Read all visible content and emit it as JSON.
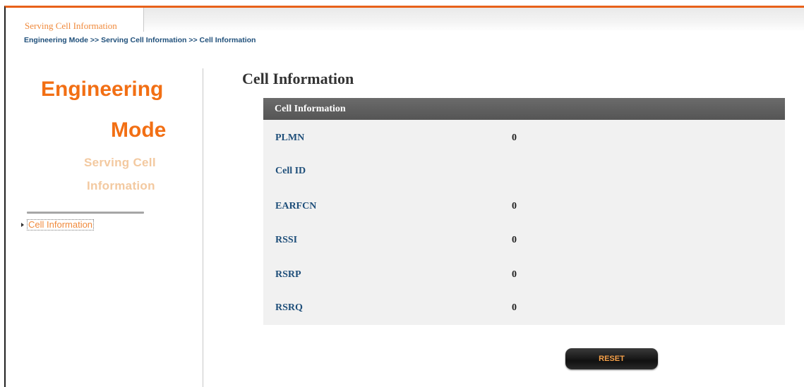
{
  "tab": {
    "label": "Serving Cell Information"
  },
  "breadcrumb": "Engineering Mode >> Serving Cell Information >> Cell Information",
  "sidebar": {
    "title_line1": "Engineering",
    "title_line2": "Mode",
    "subtitle_line1": "Serving Cell",
    "subtitle_line2": "Information",
    "items": [
      {
        "label": "Cell Information"
      }
    ]
  },
  "main": {
    "page_title": "Cell Information",
    "panel_title": "Cell Information",
    "rows": [
      {
        "label": "PLMN",
        "value": "0"
      },
      {
        "label": "Cell ID",
        "value": ""
      },
      {
        "label": "EARFCN",
        "value": "0"
      },
      {
        "label": "RSSI",
        "value": "0"
      },
      {
        "label": "RSRP",
        "value": "0"
      },
      {
        "label": "RSRQ",
        "value": "0"
      }
    ],
    "reset_label": "RESET"
  },
  "colors": {
    "accent": "#f26f14",
    "header": "#5e5e5e",
    "label": "#1f4f7a"
  }
}
